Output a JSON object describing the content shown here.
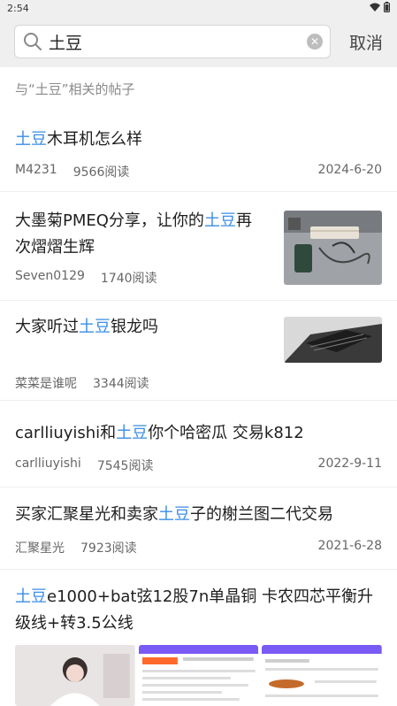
{
  "status_bar": {
    "time": "2:54"
  },
  "search": {
    "query": "土豆",
    "cancel_label": "取消"
  },
  "context_label": "与“土豆”相关的帖子",
  "posts": [
    {
      "title_pre": "",
      "title_hl": "土豆",
      "title_post": "木耳机怎么样",
      "author": "M4231",
      "reads": "9566阅读",
      "date": "2024-6-20"
    },
    {
      "title_pre": "大墨菊PMEQ分享，让你的",
      "title_hl": "土豆",
      "title_post": "再次熠熠生辉",
      "author": "Seven0129",
      "reads": "1740阅读",
      "date": ""
    },
    {
      "title_pre": "大家听过",
      "title_hl": "土豆",
      "title_post": "银龙吗",
      "author": "菜菜是谁呢",
      "reads": "3344阅读",
      "date": ""
    },
    {
      "title_pre": "carlliuyishi和",
      "title_hl": "土豆",
      "title_post": "你个哈密瓜 交易k812",
      "author": "carlliuyishi",
      "reads": "7545阅读",
      "date": "2022-9-11"
    },
    {
      "title_pre": "买家汇聚星光和卖家",
      "title_hl": "土豆",
      "title_post": "子的榭兰图二代交易",
      "author": "汇聚星光",
      "reads": "7923阅读",
      "date": "2021-6-28"
    },
    {
      "title_pre": "",
      "title_hl": "土豆",
      "title_post": "e1000+bat弦12股7n单晶铜 卡农四芯平衡升级线+转3.5公线",
      "author": "",
      "reads": "",
      "date": ""
    }
  ]
}
